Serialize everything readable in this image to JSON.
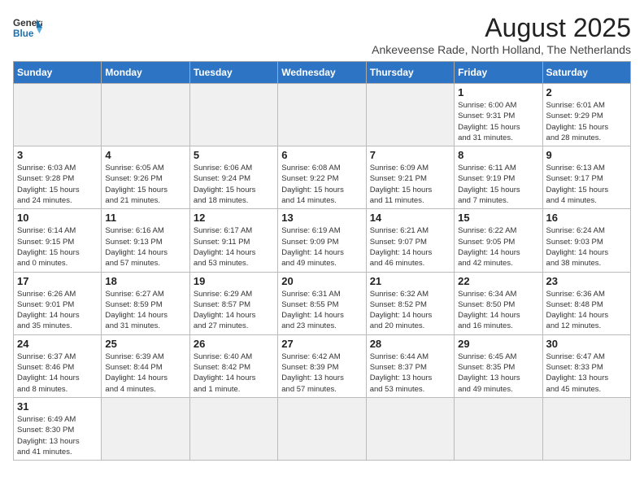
{
  "header": {
    "logo_general": "General",
    "logo_blue": "Blue",
    "month_year": "August 2025",
    "location": "Ankeveense Rade, North Holland, The Netherlands"
  },
  "days_of_week": [
    "Sunday",
    "Monday",
    "Tuesday",
    "Wednesday",
    "Thursday",
    "Friday",
    "Saturday"
  ],
  "weeks": [
    [
      {
        "num": "",
        "info": ""
      },
      {
        "num": "",
        "info": ""
      },
      {
        "num": "",
        "info": ""
      },
      {
        "num": "",
        "info": ""
      },
      {
        "num": "",
        "info": ""
      },
      {
        "num": "1",
        "info": "Sunrise: 6:00 AM\nSunset: 9:31 PM\nDaylight: 15 hours\nand 31 minutes."
      },
      {
        "num": "2",
        "info": "Sunrise: 6:01 AM\nSunset: 9:29 PM\nDaylight: 15 hours\nand 28 minutes."
      }
    ],
    [
      {
        "num": "3",
        "info": "Sunrise: 6:03 AM\nSunset: 9:28 PM\nDaylight: 15 hours\nand 24 minutes."
      },
      {
        "num": "4",
        "info": "Sunrise: 6:05 AM\nSunset: 9:26 PM\nDaylight: 15 hours\nand 21 minutes."
      },
      {
        "num": "5",
        "info": "Sunrise: 6:06 AM\nSunset: 9:24 PM\nDaylight: 15 hours\nand 18 minutes."
      },
      {
        "num": "6",
        "info": "Sunrise: 6:08 AM\nSunset: 9:22 PM\nDaylight: 15 hours\nand 14 minutes."
      },
      {
        "num": "7",
        "info": "Sunrise: 6:09 AM\nSunset: 9:21 PM\nDaylight: 15 hours\nand 11 minutes."
      },
      {
        "num": "8",
        "info": "Sunrise: 6:11 AM\nSunset: 9:19 PM\nDaylight: 15 hours\nand 7 minutes."
      },
      {
        "num": "9",
        "info": "Sunrise: 6:13 AM\nSunset: 9:17 PM\nDaylight: 15 hours\nand 4 minutes."
      }
    ],
    [
      {
        "num": "10",
        "info": "Sunrise: 6:14 AM\nSunset: 9:15 PM\nDaylight: 15 hours\nand 0 minutes."
      },
      {
        "num": "11",
        "info": "Sunrise: 6:16 AM\nSunset: 9:13 PM\nDaylight: 14 hours\nand 57 minutes."
      },
      {
        "num": "12",
        "info": "Sunrise: 6:17 AM\nSunset: 9:11 PM\nDaylight: 14 hours\nand 53 minutes."
      },
      {
        "num": "13",
        "info": "Sunrise: 6:19 AM\nSunset: 9:09 PM\nDaylight: 14 hours\nand 49 minutes."
      },
      {
        "num": "14",
        "info": "Sunrise: 6:21 AM\nSunset: 9:07 PM\nDaylight: 14 hours\nand 46 minutes."
      },
      {
        "num": "15",
        "info": "Sunrise: 6:22 AM\nSunset: 9:05 PM\nDaylight: 14 hours\nand 42 minutes."
      },
      {
        "num": "16",
        "info": "Sunrise: 6:24 AM\nSunset: 9:03 PM\nDaylight: 14 hours\nand 38 minutes."
      }
    ],
    [
      {
        "num": "17",
        "info": "Sunrise: 6:26 AM\nSunset: 9:01 PM\nDaylight: 14 hours\nand 35 minutes."
      },
      {
        "num": "18",
        "info": "Sunrise: 6:27 AM\nSunset: 8:59 PM\nDaylight: 14 hours\nand 31 minutes."
      },
      {
        "num": "19",
        "info": "Sunrise: 6:29 AM\nSunset: 8:57 PM\nDaylight: 14 hours\nand 27 minutes."
      },
      {
        "num": "20",
        "info": "Sunrise: 6:31 AM\nSunset: 8:55 PM\nDaylight: 14 hours\nand 23 minutes."
      },
      {
        "num": "21",
        "info": "Sunrise: 6:32 AM\nSunset: 8:52 PM\nDaylight: 14 hours\nand 20 minutes."
      },
      {
        "num": "22",
        "info": "Sunrise: 6:34 AM\nSunset: 8:50 PM\nDaylight: 14 hours\nand 16 minutes."
      },
      {
        "num": "23",
        "info": "Sunrise: 6:36 AM\nSunset: 8:48 PM\nDaylight: 14 hours\nand 12 minutes."
      }
    ],
    [
      {
        "num": "24",
        "info": "Sunrise: 6:37 AM\nSunset: 8:46 PM\nDaylight: 14 hours\nand 8 minutes."
      },
      {
        "num": "25",
        "info": "Sunrise: 6:39 AM\nSunset: 8:44 PM\nDaylight: 14 hours\nand 4 minutes."
      },
      {
        "num": "26",
        "info": "Sunrise: 6:40 AM\nSunset: 8:42 PM\nDaylight: 14 hours\nand 1 minute."
      },
      {
        "num": "27",
        "info": "Sunrise: 6:42 AM\nSunset: 8:39 PM\nDaylight: 13 hours\nand 57 minutes."
      },
      {
        "num": "28",
        "info": "Sunrise: 6:44 AM\nSunset: 8:37 PM\nDaylight: 13 hours\nand 53 minutes."
      },
      {
        "num": "29",
        "info": "Sunrise: 6:45 AM\nSunset: 8:35 PM\nDaylight: 13 hours\nand 49 minutes."
      },
      {
        "num": "30",
        "info": "Sunrise: 6:47 AM\nSunset: 8:33 PM\nDaylight: 13 hours\nand 45 minutes."
      }
    ],
    [
      {
        "num": "31",
        "info": "Sunrise: 6:49 AM\nSunset: 8:30 PM\nDaylight: 13 hours\nand 41 minutes."
      },
      {
        "num": "",
        "info": ""
      },
      {
        "num": "",
        "info": ""
      },
      {
        "num": "",
        "info": ""
      },
      {
        "num": "",
        "info": ""
      },
      {
        "num": "",
        "info": ""
      },
      {
        "num": "",
        "info": ""
      }
    ]
  ]
}
